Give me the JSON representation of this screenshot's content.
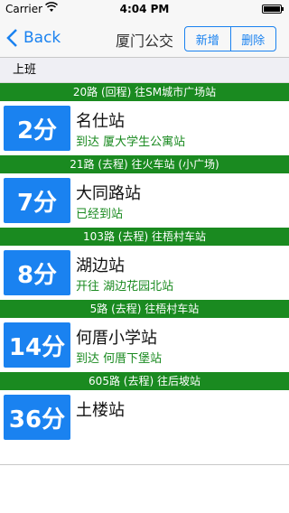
{
  "status_bar": {
    "carrier": "Carrier",
    "time": "4:04 PM"
  },
  "nav": {
    "back_label": "Back",
    "title": "厦门公交",
    "add_label": "新增",
    "delete_label": "删除"
  },
  "section": {
    "title": "上班"
  },
  "routes": [
    {
      "route_label": "20路 (回程) 往SM城市广场站",
      "eta": "2分",
      "stop_name": "名仕站",
      "status": "到达 厦大学生公寓站"
    },
    {
      "route_label": "21路 (去程) 往火车站 (小广场)",
      "eta": "7分",
      "stop_name": "大同路站",
      "status": "已经到站"
    },
    {
      "route_label": "103路 (去程) 往梧村车站",
      "eta": "8分",
      "stop_name": "湖边站",
      "status": "开往 湖边花园北站"
    },
    {
      "route_label": "5路 (去程) 往梧村车站",
      "eta": "14分",
      "stop_name": "何厝小学站",
      "status": "到达 何厝下堡站"
    },
    {
      "route_label": "605路 (去程) 往后坡站",
      "eta": "36分",
      "stop_name": "土楼站",
      "status": ""
    }
  ],
  "colors": {
    "accent": "#1a82f0",
    "route_bar": "#1a8a20",
    "status_text": "#1a8a20"
  },
  "icons": {
    "back": "chevron-left-icon",
    "wifi": "wifi-icon",
    "battery": "battery-icon"
  }
}
